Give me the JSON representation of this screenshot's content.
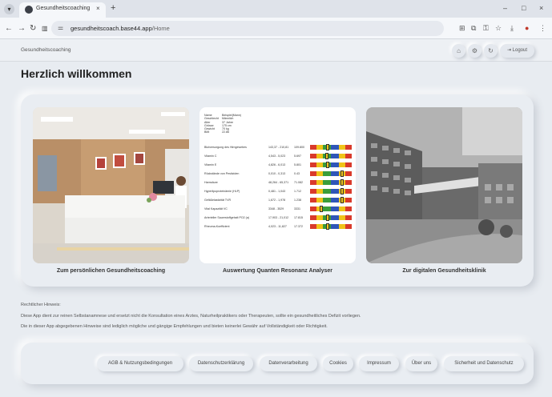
{
  "browser": {
    "tab_title": "Gesundheitscoaching",
    "tab_close": "×",
    "new_tab": "+",
    "url_host": "gesundheitscoach.base44.app",
    "url_path": "/Home",
    "window_controls": [
      "–",
      "□",
      "×"
    ],
    "nav_icons": [
      "back-icon",
      "forward-icon",
      "reload-icon",
      "tab-search-icon"
    ],
    "toolbar_icons": [
      "translate-icon",
      "install-icon",
      "key-icon",
      "bookmark-star-icon",
      "download-icon",
      "extension-icon",
      "menu-icon"
    ]
  },
  "header": {
    "brand": "Gesundheitscoaching",
    "icons": [
      "home-icon",
      "settings-icon",
      "refresh-icon"
    ],
    "logout_label": "Logout"
  },
  "main": {
    "title": "Herzlich willkommen",
    "tiles": [
      {
        "caption": "Zum persönlichen Gesundheitscoaching"
      },
      {
        "caption": "Auswertung Quanten Resonanz Analyser"
      },
      {
        "caption": "Zur digitalen Gesundheitsklinik"
      }
    ],
    "report": {
      "meta": [
        {
          "k": "Name",
          "v": "Beispiel(Mann)"
        },
        {
          "k": "Geschlecht",
          "v": "Männlich"
        },
        {
          "k": "Alter",
          "v": "37 Jahre"
        },
        {
          "k": "Grösse",
          "v": "175 cm"
        },
        {
          "k": "Gewicht",
          "v": "70 kg"
        },
        {
          "k": "BMI",
          "v": "22.86"
        }
      ],
      "rows": [
        {
          "name": "Blutversorgung des Hirngewebes",
          "range": "143,37 - 210,81",
          "value": "109.800",
          "level": 0.42
        },
        {
          "name": "Vitamin C",
          "range": "4,543 - 5,023",
          "value": "5.697",
          "level": 0.4
        },
        {
          "name": "Vitamin E",
          "range": "4,826 - 6,013",
          "value": "5.801",
          "level": 0.42
        },
        {
          "name": "Rückstände von Pestiziden",
          "range": "0,010 - 0,313",
          "value": "0.43",
          "level": 0.8
        },
        {
          "name": "Harnsäure",
          "range": "48,264 - 65,371",
          "value": "71.082",
          "level": 0.8
        },
        {
          "name": "Hyperlipoproteinämie (HLP)",
          "range": "0,481 - 1,043",
          "value": "1.712",
          "level": 0.8
        },
        {
          "name": "Gefäßelastizität TVR",
          "range": "1,672 - 1,978",
          "value": "1.238",
          "level": 0.8
        },
        {
          "name": "Vital Kapazität VC",
          "range": "3348 - 3529",
          "value": "3331",
          "level": 0.25
        },
        {
          "name": "Arterieller Sauerstoffgehalt PO2 (a)",
          "range": "17,903 - 21,012",
          "value": "17.815",
          "level": 0.42
        },
        {
          "name": "Rheuma-Koeffizient",
          "range": "4,023 - 11,827",
          "value": "17.372",
          "level": 0.42
        }
      ]
    }
  },
  "legal": {
    "heading": "Rechtlicher Hinweis:",
    "lines": [
      "Diese App dient zur reinen Selbstanamnese und ersetzt nicht die Konsultation eines Arztes, Naturheilpraktikers oder Therapeuten, sollte ein gesundheitliches Defizit vorliegen.",
      "Die in dieser App abgegebenen Hinweise sind lediglich mögliche und gängige Empfehlungen und bieten keinerlei Gewähr auf Vollständigkeit oder Richtigkeit."
    ]
  },
  "footer": {
    "links": [
      "AGB & Nutzungsbedingungen",
      "Datenschutzerklärung",
      "Datenverarbeitung",
      "Cookies",
      "Impressum",
      "Über uns",
      "Sicherheit und Datenschutz"
    ]
  },
  "colors": {
    "page_bg": "#e8ecf1",
    "card_bg": "#e9edf2",
    "bar_red": "#d93a2b",
    "bar_yellow": "#f0c419",
    "bar_green": "#3a9d3a",
    "bar_blue": "#2f56b8"
  }
}
